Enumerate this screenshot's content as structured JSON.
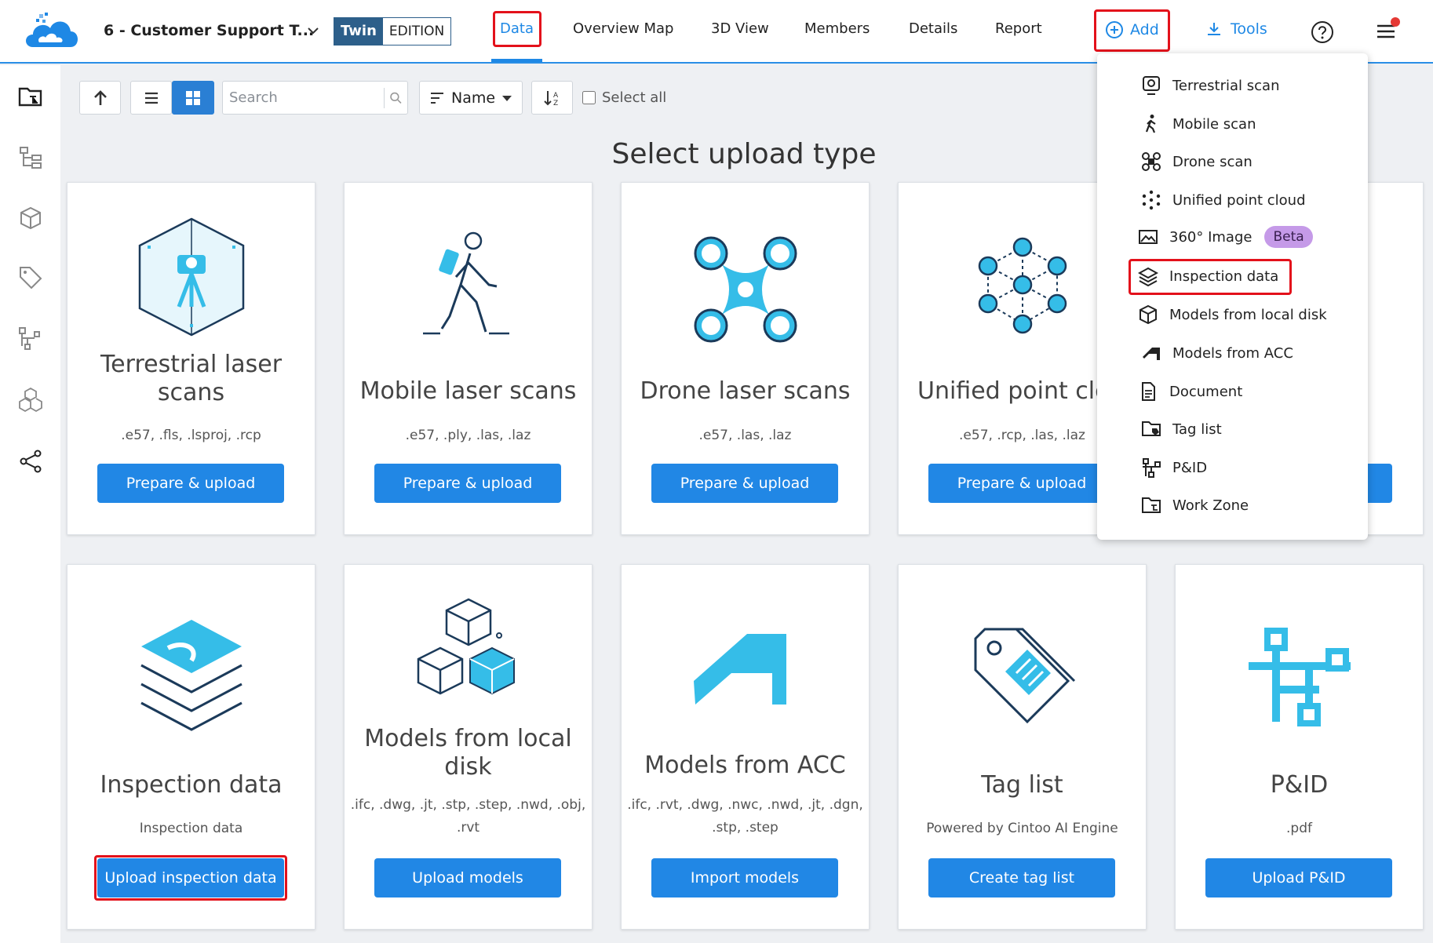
{
  "header": {
    "project_name": "6 - Customer Support T...",
    "edition_twin": "Twin",
    "edition_label": "EDITION",
    "nav": [
      "Data",
      "Overview Map",
      "3D View",
      "Members",
      "Details",
      "Report"
    ],
    "active_nav": "Data",
    "add_label": "Add",
    "tools_label": "Tools",
    "accent_color": "#1e88e5",
    "highlight_color": "#e3111b"
  },
  "sidebar": {
    "icons": [
      "folder-tree-icon",
      "hierarchy-icon",
      "cube-icon",
      "tag-icon",
      "pid-icon",
      "cubes-icon",
      "share-icon"
    ]
  },
  "toolbar": {
    "search_placeholder": "Search",
    "sort_label": "Name",
    "select_all_label": "Select all"
  },
  "main": {
    "title": "Select upload type",
    "cards": [
      {
        "title": "Terrestrial laser scans",
        "sub": ".e57, .fls, .lsproj, .rcp",
        "button": "Prepare & upload"
      },
      {
        "title": "Mobile laser scans",
        "sub": ".e57, .ply, .las, .laz",
        "button": "Prepare & upload"
      },
      {
        "title": "Drone laser scans",
        "sub": ".e57, .las, .laz",
        "button": "Prepare & upload"
      },
      {
        "title": "Unified point clo",
        "sub": ".e57, .rcp, .las, .laz",
        "button": "Prepare & upload"
      },
      {
        "title": "Inspection data",
        "sub": "Inspection data",
        "button": "Upload inspection data"
      },
      {
        "title": "Models from local disk",
        "sub": ".ifc, .dwg, .jt, .stp, .step, .nwd, .obj, .rvt",
        "button": "Upload models"
      },
      {
        "title": "Models from ACC",
        "sub": ".ifc, .rvt, .dwg, .nwc, .nwd, .jt, .dgn, .stp, .step",
        "button": "Import models"
      },
      {
        "title": "Tag list",
        "sub": "Powered by Cintoo AI Engine",
        "button": "Create tag list"
      },
      {
        "title": "P&ID",
        "sub": ".pdf",
        "button": "Upload P&ID"
      }
    ]
  },
  "add_menu": {
    "items": [
      {
        "label": "Terrestrial scan",
        "icon": "terrestrial-scan-icon"
      },
      {
        "label": "Mobile scan",
        "icon": "walking-person-icon"
      },
      {
        "label": "Drone scan",
        "icon": "drone-icon"
      },
      {
        "label": "Unified point cloud",
        "icon": "point-cloud-icon"
      },
      {
        "label": "360° Image",
        "icon": "panorama-icon",
        "badge": "Beta"
      },
      {
        "label": "Inspection data",
        "icon": "layers-icon"
      },
      {
        "label": "Models from local disk",
        "icon": "cube-icon"
      },
      {
        "label": "Models from ACC",
        "icon": "acc-icon"
      },
      {
        "label": "Document",
        "icon": "document-icon"
      },
      {
        "label": "Tag list",
        "icon": "tag-folder-icon"
      },
      {
        "label": "P&ID",
        "icon": "pid-icon"
      },
      {
        "label": "Work Zone",
        "icon": "work-zone-icon"
      }
    ]
  }
}
